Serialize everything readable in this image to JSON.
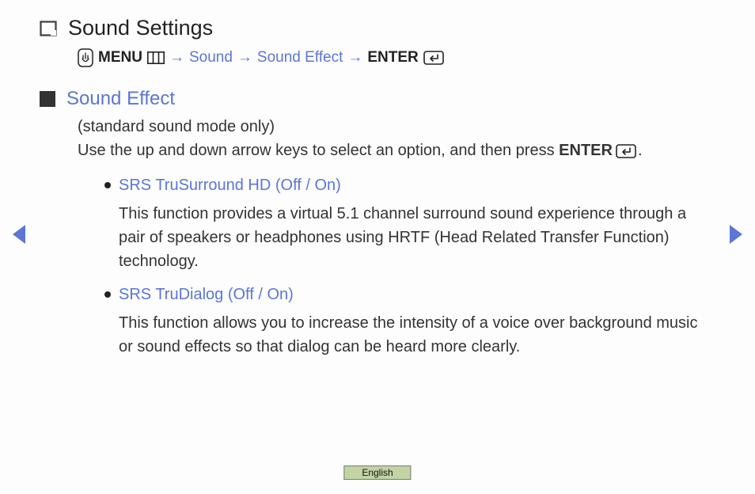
{
  "title": "Sound Settings",
  "breadcrumb": {
    "menu": "MENU",
    "arrow": "→",
    "sound": "Sound",
    "sound_effect": "Sound Effect",
    "enter": "ENTER"
  },
  "section": {
    "title": "Sound Effect",
    "note": "(standard sound mode only)",
    "instruction_pre": "Use the up and down arrow keys to select an option, and then press ",
    "instruction_bold": "ENTER",
    "instruction_end": "."
  },
  "items": [
    {
      "title": "SRS TruSurround HD (Off / On)",
      "desc": "This function provides a virtual 5.1 channel surround sound experience through a pair of speakers or headphones using HRTF (Head Related Transfer Function) technology."
    },
    {
      "title": "SRS TruDialog (Off / On)",
      "desc": "This function allows you to increase the intensity of a voice over background music or sound effects so that dialog can be heard more clearly."
    }
  ],
  "footer": {
    "language": "English"
  },
  "colors": {
    "link": "#5b76d4",
    "badge": "#c2d3a4"
  }
}
